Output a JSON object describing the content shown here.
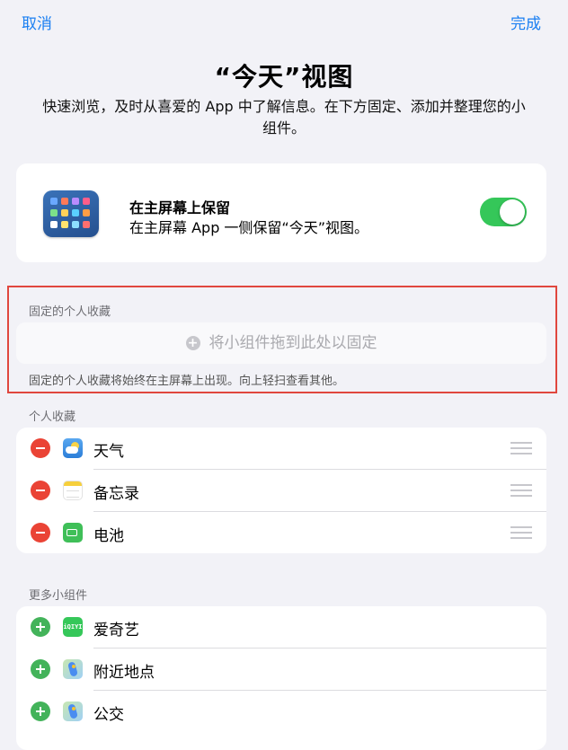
{
  "nav": {
    "cancel": "取消",
    "done": "完成"
  },
  "title": "“今天”视图",
  "subtitle": "快速浏览，及时从喜爱的 App 中了解信息。在下方固定、添加并整理您的小组件。",
  "keep": {
    "title": "在主屏幕上保留",
    "desc": "在主屏幕 App 一侧保留“今天”视图。",
    "toggle_on": true
  },
  "pinned": {
    "header": "固定的个人收藏",
    "drop_hint": "将小组件拖到此处以固定",
    "footer": "固定的个人收藏将始终在主屏幕上出现。向上轻扫查看其他。"
  },
  "favorites": {
    "header": "个人收藏",
    "items": [
      {
        "label": "天气",
        "icon": "weather-icon"
      },
      {
        "label": "备忘录",
        "icon": "notes-icon"
      },
      {
        "label": "电池",
        "icon": "battery-icon"
      }
    ]
  },
  "more": {
    "header": "更多小组件",
    "items": [
      {
        "label": "爱奇艺",
        "icon": "iqiyi-icon",
        "icon_text": "iQIYI"
      },
      {
        "label": "附近地点",
        "icon": "maps-icon"
      },
      {
        "label": "公交",
        "icon": "maps-icon"
      }
    ]
  },
  "colors": {
    "accent": "#1a7ff2",
    "toggle": "#35c759",
    "remove": "#ea4335",
    "add": "#43b35a",
    "highlight": "#e0473e"
  }
}
